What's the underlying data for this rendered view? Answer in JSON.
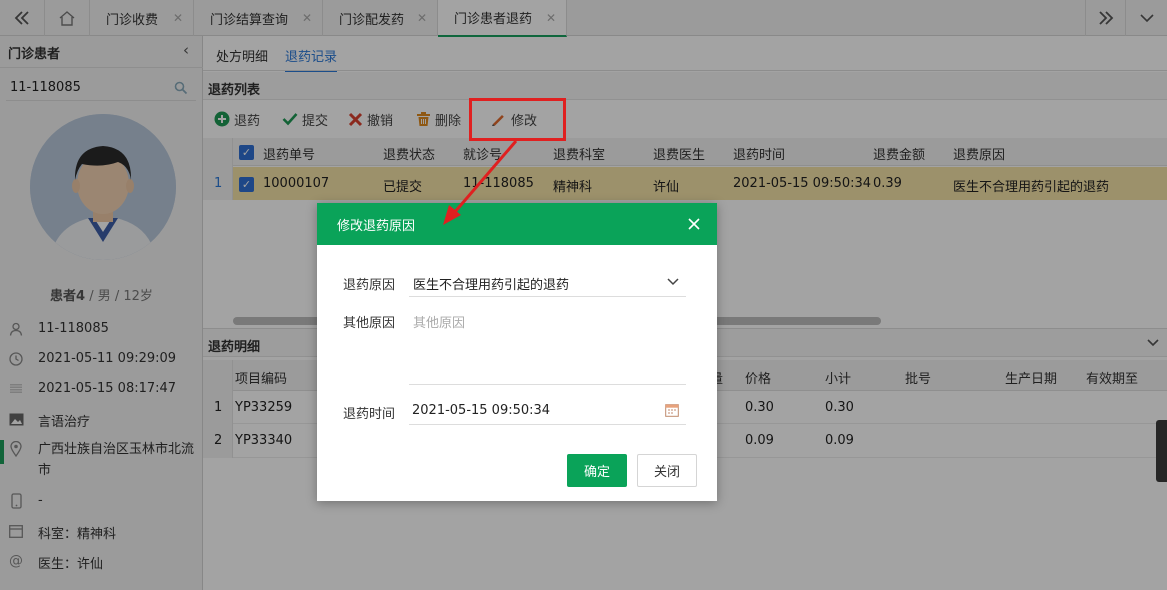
{
  "top_tabs": [
    {
      "label": "门诊收费"
    },
    {
      "label": "门诊结算查询"
    },
    {
      "label": "门诊配发药"
    },
    {
      "label": "门诊患者退药"
    }
  ],
  "left": {
    "title": "门诊患者",
    "search_value": "11-118085",
    "patient_name": "患者4",
    "patient_meta": " / 男 / 12岁",
    "rows": [
      {
        "icon": "person-icon",
        "text": "11-118085"
      },
      {
        "icon": "clock-icon",
        "text": "2021-05-11 09:29:09"
      },
      {
        "icon": "barcode-icon",
        "text": "2021-05-15 08:17:47"
      },
      {
        "icon": "image-icon",
        "text": "言语治疗"
      },
      {
        "icon": "location-icon",
        "text": "广西壮族自治区玉林市北流市"
      },
      {
        "icon": "phone-icon",
        "text": "-"
      },
      {
        "icon": "window-icon",
        "text": "科室：精神科"
      },
      {
        "icon": "at-icon",
        "text": "医生：许仙"
      }
    ]
  },
  "subtabs": [
    "处方明细",
    "退药记录"
  ],
  "return_list": {
    "title": "退药列表",
    "toolbar": [
      "退药",
      "提交",
      "撤销",
      "删除",
      "修改"
    ],
    "headers": [
      "退药单号",
      "退费状态",
      "就诊号",
      "退费科室",
      "退费医生",
      "退药时间",
      "退费金额",
      "退费原因"
    ],
    "row": {
      "index": "1",
      "no": "10000107",
      "status": "已提交",
      "visit": "11-118085",
      "dept": "精神科",
      "doctor": "许仙",
      "time": "2021-05-15 09:50:34",
      "amount": "0.39",
      "reason": "医生不合理用药引起的退药"
    }
  },
  "detail": {
    "title": "退药明细",
    "headers": [
      "项目编码",
      "量",
      "价格",
      "小计",
      "批号",
      "生产日期",
      "有效期至"
    ],
    "rows": [
      {
        "index": "1",
        "code": "YP33259",
        "price": "0.30",
        "subtotal": "0.30"
      },
      {
        "index": "2",
        "code": "YP33340",
        "price": "0.09",
        "subtotal": "0.09"
      }
    ]
  },
  "dialog": {
    "title": "修改退药原因",
    "reason_label": "退药原因",
    "reason_value": "医生不合理用药引起的退药",
    "other_label": "其他原因",
    "other_placeholder": "其他原因",
    "time_label": "退药时间",
    "time_value": "2021-05-15 09:50:34",
    "ok": "确定",
    "close": "关闭"
  },
  "colors": {
    "accent": "#0aa359",
    "highlight": "#f5e3a8",
    "annotation": "#e02020",
    "link": "#2b79d8"
  }
}
